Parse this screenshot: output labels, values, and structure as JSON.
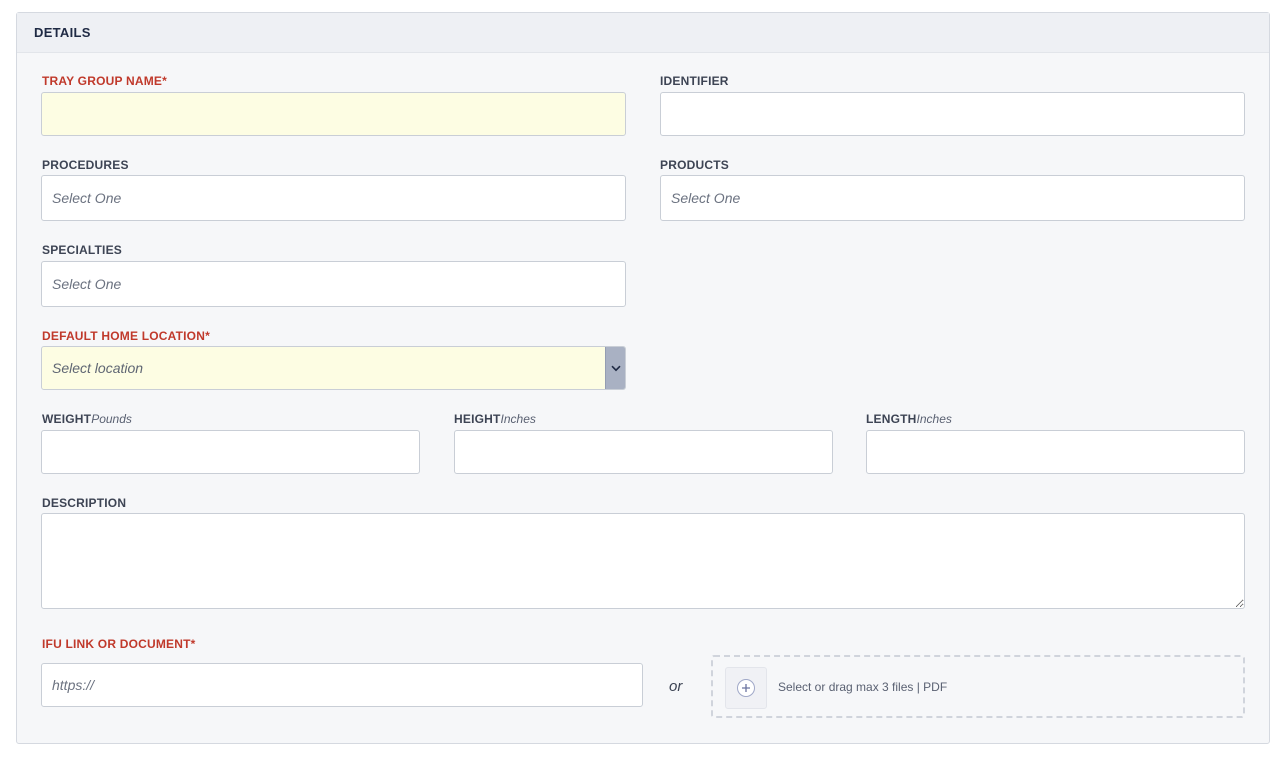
{
  "section": {
    "title": "DETAILS"
  },
  "fields": {
    "tray_group_name": {
      "label": "TRAY GROUP NAME*",
      "value": ""
    },
    "identifier": {
      "label": "IDENTIFIER",
      "value": ""
    },
    "procedures": {
      "label": "PROCEDURES",
      "placeholder": "Select One"
    },
    "products": {
      "label": "PRODUCTS",
      "placeholder": "Select One"
    },
    "specialties": {
      "label": "SPECIALTIES",
      "placeholder": "Select One"
    },
    "default_home_location": {
      "label": "DEFAULT HOME LOCATION*",
      "placeholder": "Select location"
    },
    "weight": {
      "label": "WEIGHT",
      "unit": "Pounds",
      "value": ""
    },
    "height": {
      "label": "HEIGHT",
      "unit": "Inches",
      "value": ""
    },
    "length": {
      "label": "LENGTH",
      "unit": "Inches",
      "value": ""
    },
    "description": {
      "label": "DESCRIPTION",
      "value": ""
    },
    "ifu": {
      "label": "IFU LINK OR DOCUMENT*",
      "placeholder": "https://",
      "or_text": "or",
      "dropzone_text": "Select or drag max 3 files | PDF"
    }
  },
  "colors": {
    "required_label": "#c0392b",
    "highlight_field": "#fdfde3",
    "select_button": "#a9b1c3"
  },
  "icons": {
    "dropdown": "chevron-down-icon",
    "add_file": "plus-circle-icon"
  }
}
